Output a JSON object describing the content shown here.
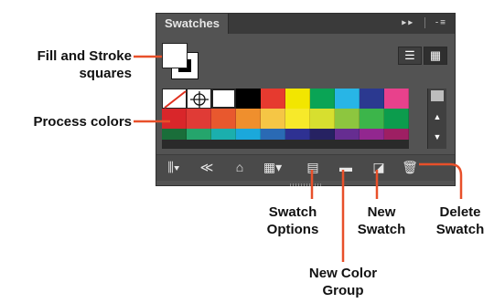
{
  "panel": {
    "tab_title": "Swatches",
    "tab_tools": "▸▸",
    "menu_icon": "-≡",
    "view_list_icon": "☰",
    "view_grid_icon": "▦"
  },
  "swatch_rows": [
    [
      "none",
      "registration",
      "#ffffff",
      "#000000",
      "#e63a2f",
      "#f2e600",
      "#0aa455",
      "#28b5e6",
      "#2b3990",
      "#e8418c"
    ],
    [
      "#d9262a",
      "#e03b36",
      "#e8582e",
      "#ef8f2d",
      "#f5c645",
      "#f7e92a",
      "#d7df2f",
      "#8dc63f",
      "#3cb54a",
      "#0c9c4d"
    ],
    [
      "#1a6e3a",
      "#25a56c",
      "#1bafad",
      "#1ba8db",
      "#2a6ab4",
      "#2e3192",
      "#262262",
      "#662d91",
      "#92278f",
      "#9e1f63"
    ]
  ],
  "bottom_icons": [
    {
      "name": "swatch-libraries-icon",
      "glyph": "⫼▾"
    },
    {
      "name": "show-swatch-kinds-icon",
      "glyph": "≪"
    },
    {
      "name": "open-color-themes-icon",
      "glyph": "⌂"
    },
    {
      "name": "kind-menu-icon",
      "glyph": "▦▾"
    },
    {
      "name": "swatch-options-icon",
      "glyph": "▤"
    },
    {
      "name": "new-color-group-icon",
      "glyph": "▬"
    },
    {
      "name": "new-swatch-icon",
      "glyph": "◪"
    },
    {
      "name": "delete-swatch-icon",
      "glyph": "🗑"
    }
  ],
  "callouts": {
    "fill_stroke_1": "Fill and Stroke",
    "fill_stroke_2": "squares",
    "process_colors": "Process colors",
    "swatch_options_1": "Swatch",
    "swatch_options_2": "Options",
    "new_swatch_1": "New",
    "new_swatch_2": "Swatch",
    "delete_swatch_1": "Delete",
    "delete_swatch_2": "Swatch",
    "new_group_1": "New Color",
    "new_group_2": "Group"
  },
  "colors": {
    "callout_line": "#e8502a"
  }
}
